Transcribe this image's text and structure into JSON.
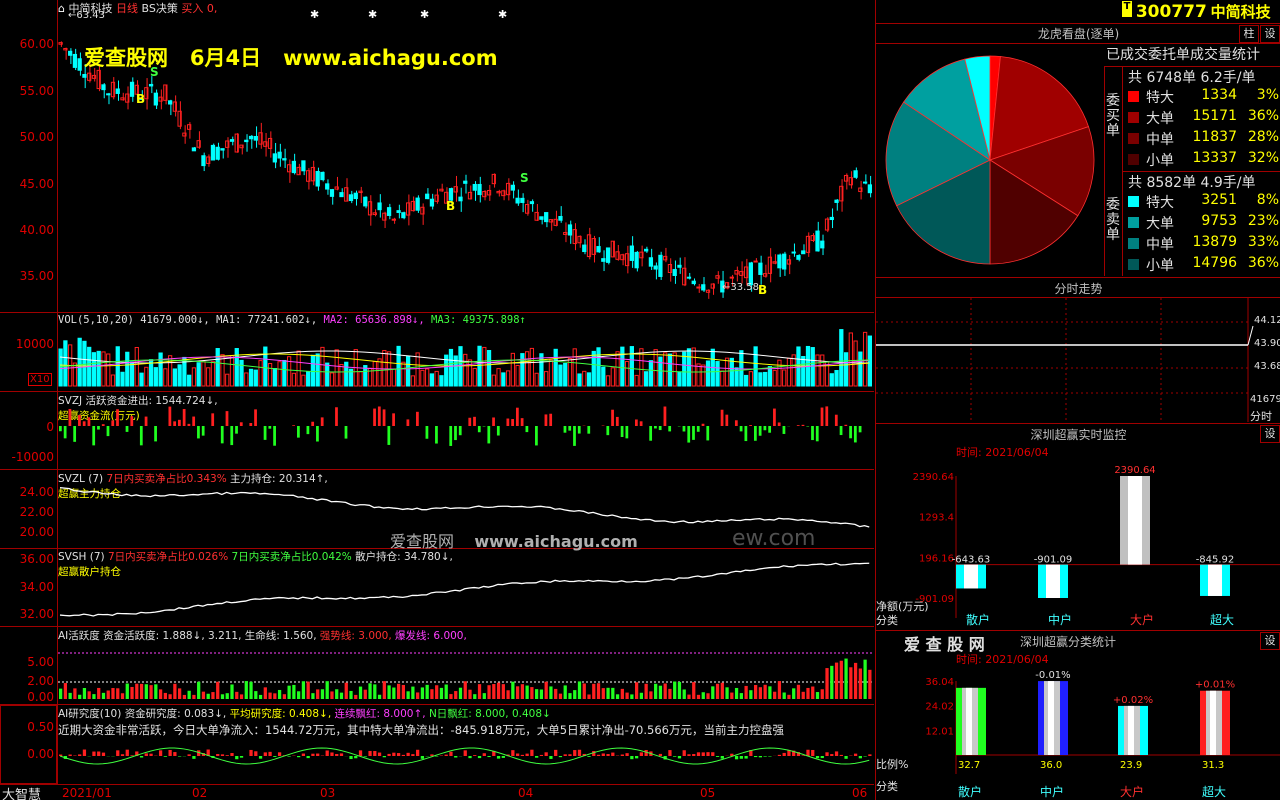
{
  "header": {
    "stock_name": "中简科技",
    "period": "日线",
    "strategy": "BS决策",
    "buy_label": "买入",
    "buy_value": "0,",
    "high_mark": "63.43",
    "low_mark": "33.58"
  },
  "watermark": {
    "banner": "爱查股网   6月4日   www.aichagu.com",
    "mid_cn": "爱查股网",
    "mid_url": "www.aichagu.com",
    "mid_ghost": "ew.com"
  },
  "price_axis": [
    "60.00",
    "55.00",
    "50.00",
    "45.00",
    "40.00",
    "35.00"
  ],
  "vol": {
    "line": [
      "VOL(5,10,20)",
      "41679.000↓,",
      "MA1: 77241.602↓,",
      "MA2: 65636.898↓,",
      "MA3: 49375.898↑"
    ],
    "axis": [
      "10000"
    ],
    "unit": "X10"
  },
  "svzj": {
    "line1": "SVZJ  活跃资金进出: 1544.724↓,",
    "line2": "超赢资金流(万元)",
    "axis": [
      "0",
      "-10000"
    ]
  },
  "svzl": {
    "name": "SVZL (7)",
    "ratio": "7日内买卖净占比0.343%",
    "hold": "主力持仓: 20.314↑,",
    "line2": "超赢主力持仓",
    "axis": [
      "24.00",
      "22.00",
      "20.00"
    ]
  },
  "svsh": {
    "name": "SVSH (7)",
    "ratio1": "7日内买卖净占比0.026%",
    "ratio2": "7日内买卖净占比0.042%",
    "hold": "散户持仓: 34.780↓,",
    "line2": "超赢散户持仓",
    "axis": [
      "36.00",
      "34.00",
      "32.00"
    ]
  },
  "ai_act": {
    "t1": "AI活跃度",
    "t2": "资金活跃度: 1.888↓,",
    "t3": "3.211,",
    "t4": "生命线: 1.560,",
    "t5": "强势线: 3.000,",
    "t6": "爆发线: 6.000,",
    "axis": [
      "5.00",
      "2.00",
      "0.00"
    ]
  },
  "ai_res": {
    "t1": "AI研究度(10)",
    "t2": "资金研究度: 0.083↓,",
    "t3": "平均研究度: 0.408↓,",
    "t4": "连续飘红: 8.000↑,",
    "t5": "N日飘红: 8.000,",
    "t6": "0.408↓",
    "comment": "近期大资金非常活跃，今日大单净流入：1544.72万元，其中特大单净流出：-845.918万元，大单5日累计净出-70.566万元，当前主力控盘强",
    "axis": [
      "0.50",
      "0.00"
    ]
  },
  "bottom": {
    "brand": "大智慧",
    "dates": [
      "2021/01",
      "02",
      "03",
      "04",
      "05",
      "06"
    ]
  },
  "right": {
    "code": "300777",
    "name": "中简科技",
    "btn_col": "柱",
    "btn_set": "设",
    "dragon_title": "龙虎看盘(逐单)",
    "stats_title": "已成交委托单成交量统计",
    "buy_side": "委买单",
    "sell_side": "委卖单",
    "buy_total": "共 6748单 6.2手/单",
    "sell_total": "共 8582单 4.9手/单",
    "buy_rows": [
      {
        "label": "特大",
        "num": "1334",
        "pct": "3%",
        "color": "#ff0000"
      },
      {
        "label": "大单",
        "num": "15171",
        "pct": "36%",
        "color": "#a00000"
      },
      {
        "label": "中单",
        "num": "11837",
        "pct": "28%",
        "color": "#7a0000"
      },
      {
        "label": "小单",
        "num": "13337",
        "pct": "32%",
        "color": "#500000"
      }
    ],
    "sell_rows": [
      {
        "label": "特大",
        "num": "3251",
        "pct": "8%",
        "color": "#00ffff"
      },
      {
        "label": "大单",
        "num": "9753",
        "pct": "23%",
        "color": "#00a0a0"
      },
      {
        "label": "中单",
        "num": "13879",
        "pct": "33%",
        "color": "#008080"
      },
      {
        "label": "小单",
        "num": "14796",
        "pct": "36%",
        "color": "#005858"
      }
    ],
    "intraday_title": "分时走势",
    "intraday_axis": [
      "44.12",
      "43.90",
      "43.68",
      "41679",
      "分时"
    ],
    "monitor_title": "深圳超赢实时监控",
    "monitor_time": "时间: 2021/06/04",
    "monitor_axis": [
      "2390.64",
      "1293.4",
      "196.16",
      "-901.09"
    ],
    "monitor_ylabel": "净额(万元)",
    "monitor_xlabel": "分类",
    "monitor_cats": [
      "散户",
      "中户",
      "大户",
      "超大"
    ],
    "monitor_values": [
      "-643.63",
      "-901.09",
      "2390.64",
      "-845.92"
    ],
    "cls_brand": "爱 查 股 网",
    "cls_title": "深圳超赢分类统计",
    "cls_time": "时间: 2021/06/04",
    "cls_axis": [
      "36.04",
      "24.02",
      "12.01"
    ],
    "cls_ylabel": "比例%",
    "cls_xlabel": "分类",
    "cls_cats": [
      "散户",
      "中户",
      "大户",
      "超大"
    ],
    "cls_values": [
      "32.7",
      "36.0",
      "23.9",
      "31.3"
    ],
    "cls_changes": [
      "",
      "-0.01%",
      "+0.02%",
      "+0.01%"
    ]
  },
  "chart_data": [
    {
      "type": "pie",
      "title": "龙虎看盘(逐单)",
      "categories": [
        "买特大",
        "买大单",
        "买中单",
        "买小单",
        "卖小单",
        "卖中单",
        "卖大单",
        "卖特大"
      ],
      "values": [
        1334,
        15171,
        11837,
        13337,
        14796,
        13879,
        9753,
        3251
      ]
    },
    {
      "type": "bar",
      "title": "深圳超赢实时监控",
      "categories": [
        "散户",
        "中户",
        "大户",
        "超大"
      ],
      "values": [
        -643.63,
        -901.09,
        2390.64,
        -845.92
      ],
      "ylim": [
        -901.09,
        2390.64
      ]
    },
    {
      "type": "bar",
      "title": "深圳超赢分类统计",
      "categories": [
        "散户",
        "中户",
        "大户",
        "超大"
      ],
      "values": [
        32.7,
        36.0,
        23.9,
        31.3
      ],
      "ylim": [
        0,
        36.04
      ]
    }
  ]
}
